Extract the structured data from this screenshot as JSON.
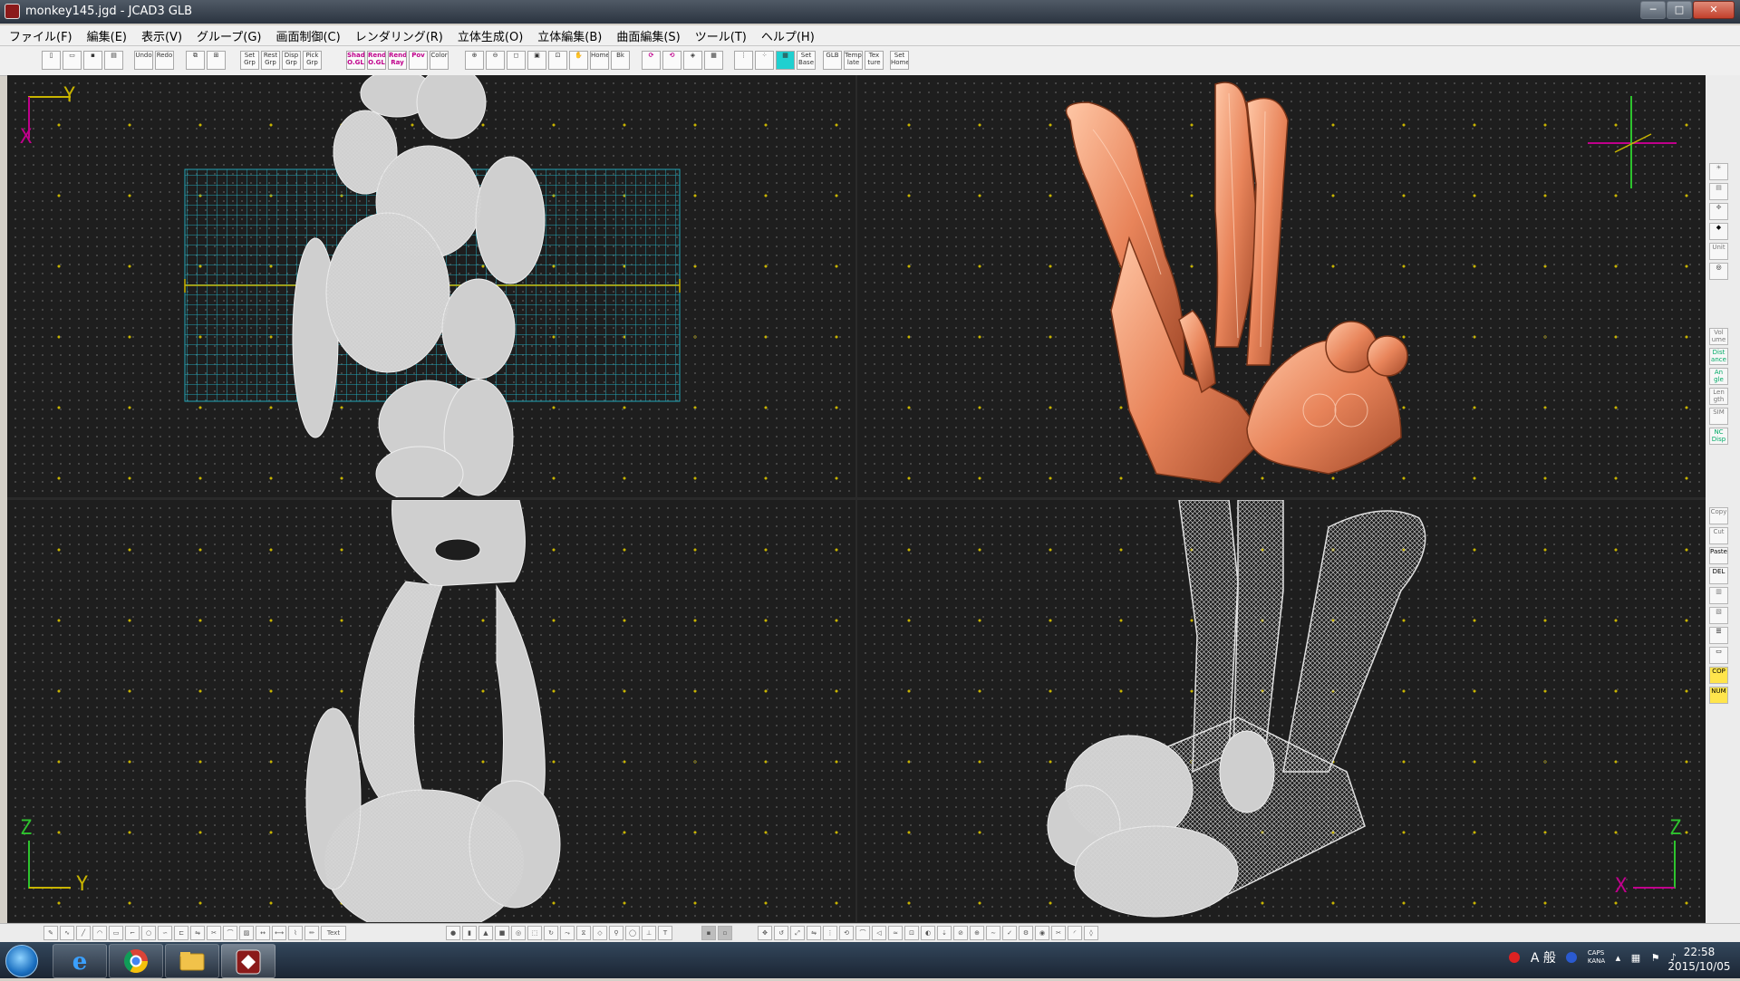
{
  "window": {
    "title": "monkey145.jgd - JCAD3 GLB",
    "buttons": {
      "minimize": "─",
      "maximize": "□",
      "close": "✕"
    }
  },
  "menu": [
    {
      "label": "ファイル(F)"
    },
    {
      "label": "編集(E)"
    },
    {
      "label": "表示(V)"
    },
    {
      "label": "グループ(G)"
    },
    {
      "label": "画面制御(C)"
    },
    {
      "label": "レンダリング(R)"
    },
    {
      "label": "立体生成(O)"
    },
    {
      "label": "立体編集(B)"
    },
    {
      "label": "曲面編集(S)"
    },
    {
      "label": "ツール(T)"
    },
    {
      "label": "ヘルプ(H)"
    }
  ],
  "toolbar": {
    "undo": "Undo",
    "redo": "Redo",
    "set_grp": "Set Grp",
    "rest_grp": "Rest Grp",
    "disp_grp": "Disp Grp",
    "pick_grp": "Pick Grp",
    "shad_ogl": "Shad O.GL",
    "rend_ogl": "Rend O.GL",
    "rend_ray": "Rend Ray",
    "pov": "Pov",
    "color": "Color",
    "home": "Home",
    "back": "Bk",
    "set_base": "Set Base",
    "glb": "GLB",
    "template": "Temp late",
    "texture": "Tex ture",
    "set_home": "Set Home"
  },
  "viewports": {
    "top_left": {
      "axis_v": "Y",
      "axis_h": "X"
    },
    "bottom_left": {
      "axis_v": "Z",
      "axis_h": "Y"
    },
    "bottom_right": {
      "axis_v": "Z",
      "axis_h": "X"
    }
  },
  "sidebar": {
    "unit": "Unit",
    "volume": "Vol ume",
    "distance": "Dist ance",
    "angle": "An gle",
    "length": "Len gth",
    "sim": "SIM",
    "nc_disp": "NC Disp",
    "copy": "Copy",
    "cut": "Cut",
    "paste": "Paste",
    "del": "DEL",
    "cop": "COP",
    "num": "NUM"
  },
  "bottom_toolbar": {
    "text_button": "Text"
  },
  "taskbar": {
    "tray_text": "A 般",
    "caps": "CAPS",
    "kana": "KANA",
    "time": "22:58",
    "date": "2015/10/05"
  },
  "colors": {
    "viewport_bg": "#1e1e1e",
    "wireframe": "#d9d9d9",
    "grid_plane": "#23a6b8",
    "render": "#e8845a",
    "axis_yellow": "#c8b400",
    "axis_magenta": "#c0008c"
  }
}
